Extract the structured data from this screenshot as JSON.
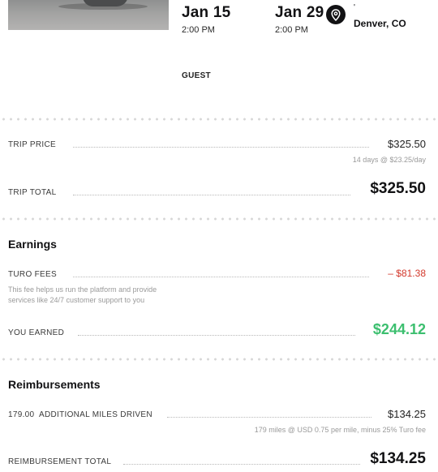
{
  "trip": {
    "start_date": "Jan 15",
    "start_time": "2:00 PM",
    "end_date": "Jan 29",
    "end_time": "2:00 PM",
    "location_line1": "'",
    "location": "Denver, CO",
    "guest_label": "GUEST"
  },
  "pricing": {
    "trip_price_label": "TRIP PRICE",
    "trip_price_value": "$325.50",
    "trip_price_detail": "14 days @ $23.25/day",
    "trip_total_label": "TRIP TOTAL",
    "trip_total_value": "$325.50"
  },
  "earnings": {
    "heading": "Earnings",
    "fees_label": "TURO FEES",
    "fees_value": "– $81.38",
    "fees_note_line1": "This fee helps us run the platform and provide",
    "fees_note_line2": "services like 24/7 customer support to you",
    "earned_label": "YOU EARNED",
    "earned_value": "$244.12",
    "earned_color": "#3cbf6f",
    "fees_color": "#d3392c"
  },
  "reimbursements": {
    "heading": "Reimbursements",
    "miles_qty": "179.00",
    "miles_label": "ADDITIONAL MILES DRIVEN",
    "miles_value": "$134.25",
    "miles_detail": "179 miles @ USD 0.75 per mile, minus 25% Turo fee",
    "total_label": "REIMBURSEMENT TOTAL",
    "total_value": "$134.25"
  },
  "icons": {
    "location": "map-pin-icon"
  }
}
